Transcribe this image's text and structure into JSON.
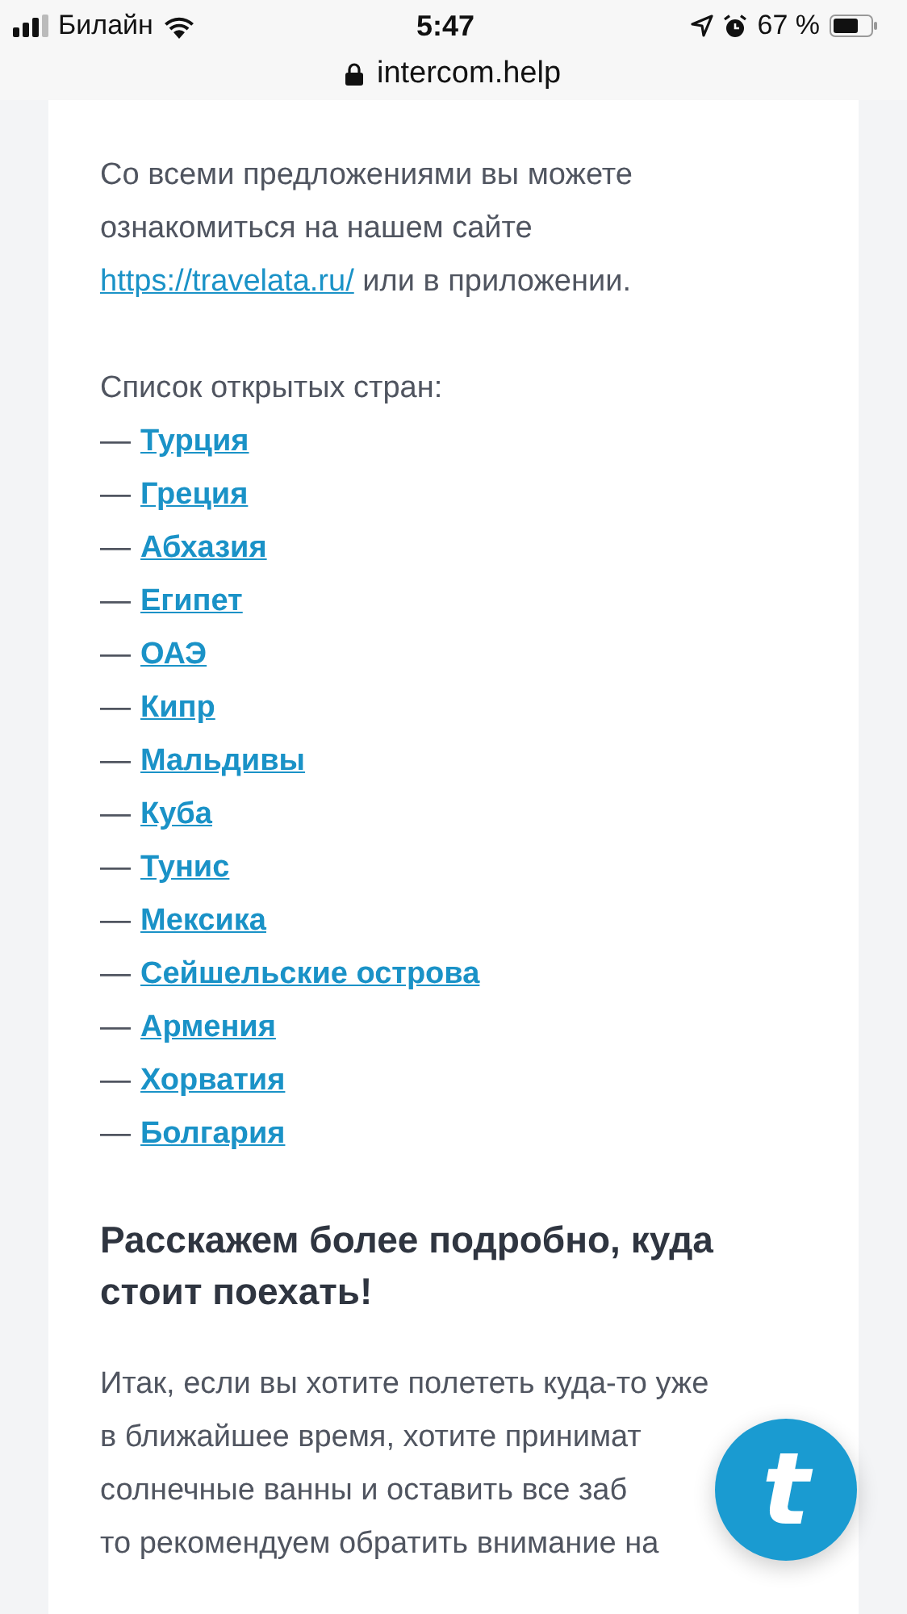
{
  "status_bar": {
    "carrier": "Билайн",
    "time": "5:47",
    "battery_text": "67 %"
  },
  "address_bar": {
    "url": "intercom.help"
  },
  "article": {
    "intro": {
      "before": "Со всеми предложениями вы можете ознакомиться на нашем сайте",
      "link": "https://travelata.ru/",
      "after": "или в приложении."
    },
    "list_title": "Список открытых стран:",
    "countries": [
      {
        "dash": "—",
        "link": "Турция"
      },
      {
        "dash": "—",
        "link": "Греция"
      },
      {
        "dash": "—",
        "link": "Абхазия"
      },
      {
        "dash": "—",
        "link": "Египет"
      },
      {
        "dash": "—",
        "link": "ОАЭ"
      },
      {
        "dash": "—",
        "link": "Кипр"
      },
      {
        "dash": "—",
        "link": "Мальдивы"
      },
      {
        "dash": "—",
        "link": "Куба"
      },
      {
        "dash": "—",
        "link": "Тунис"
      },
      {
        "dash": "—",
        "link": "Мексика"
      },
      {
        "dash": "—",
        "link": "Сейшельские острова"
      },
      {
        "dash": "—",
        "link": "Армения"
      },
      {
        "dash": "—",
        "link": "Хорватия"
      },
      {
        "dash": "—",
        "link": "Болгария"
      }
    ],
    "heading": "Расскажем более подробно, куда стоит поехать!",
    "paragraph_lines": [
      "Итак, если вы хотите полететь куда-то уже",
      "в ближайшее время, хотите принимат",
      "солнечные ванны и оставить все заб",
      "то рекомендуем обратить внимание на"
    ]
  },
  "launcher": {
    "label": "t"
  }
}
